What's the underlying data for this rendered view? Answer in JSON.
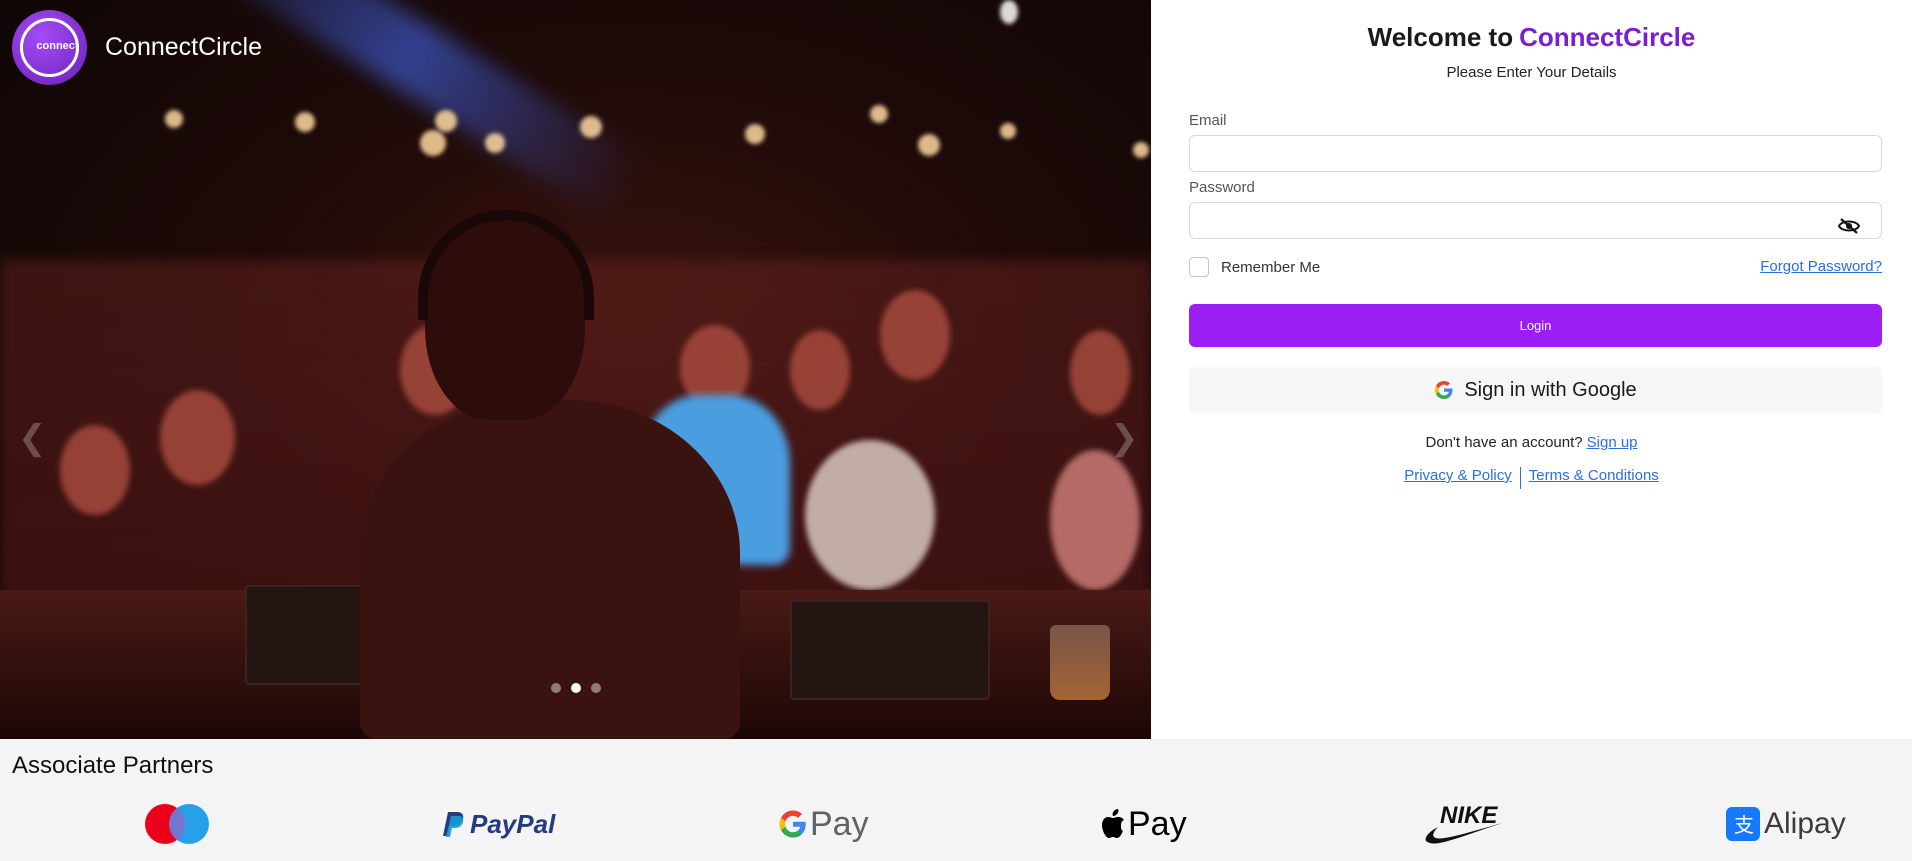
{
  "brand": {
    "logo_text": "connect",
    "name": "ConnectCircle"
  },
  "carousel": {
    "prev_icon": "chevron-left-icon",
    "next_icon": "chevron-right-icon",
    "slide_count": 3,
    "active_slide": 2
  },
  "login": {
    "welcome_prefix": "Welcome to",
    "welcome_brand": "ConnectCircle",
    "subtitle": "Please Enter Your Details",
    "email_label": "Email",
    "email_value": "",
    "password_label": "Password",
    "password_value": "",
    "password_toggle_icon": "eye-slash-icon",
    "remember_label": "Remember Me",
    "remember_checked": false,
    "forgot_label": "Forgot Password?",
    "login_label": "Login",
    "google_label": "Sign in with Google",
    "signup_prompt": "Don't have an account?",
    "signup_link": "Sign up",
    "privacy_link": "Privacy & Policy",
    "terms_link": "Terms & Conditions"
  },
  "partners": {
    "title": "Associate Partners",
    "logos": [
      {
        "name": "maestro-logo"
      },
      {
        "name": "paypal-logo",
        "text": "PayPal"
      },
      {
        "name": "google-pay-logo",
        "text": "Pay"
      },
      {
        "name": "apple-pay-logo",
        "text": "Pay"
      },
      {
        "name": "nike-logo",
        "text": "NIKE"
      },
      {
        "name": "alipay-logo",
        "text": "Alipay"
      }
    ]
  },
  "colors": {
    "accent": "#9b1ff5",
    "brand_text": "#7a1fd0",
    "link": "#2a6fe0"
  }
}
